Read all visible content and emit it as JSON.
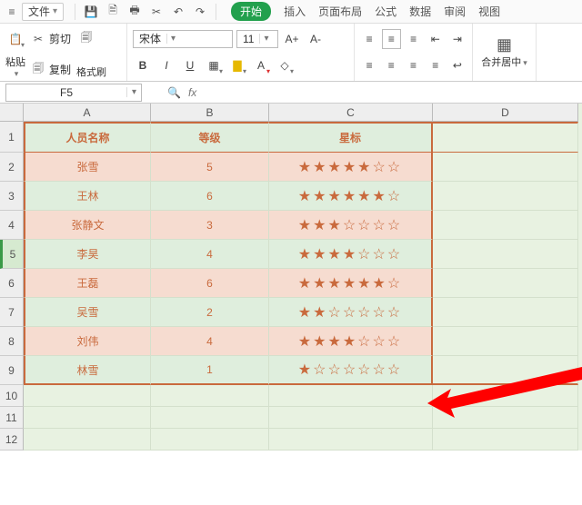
{
  "menubar": {
    "file_label": "文件",
    "tabs": [
      "开始",
      "插入",
      "页面布局",
      "公式",
      "数据",
      "审阅",
      "视图"
    ],
    "active_tab": "开始"
  },
  "ribbon": {
    "cut": "剪切",
    "copy": "复制",
    "paste": "粘贴",
    "format_painter": "格式刷",
    "font_name": "宋体",
    "font_size": "11",
    "increase_font": "A+",
    "decrease_font": "A-",
    "merge": "合并居中"
  },
  "namebox": "F5",
  "columns": [
    "A",
    "B",
    "C",
    "D"
  ],
  "headers": {
    "name": "人员名称",
    "level": "等级",
    "stars": "星标"
  },
  "rows": [
    {
      "name": "张雪",
      "level": "5",
      "stars": "★★★★★☆☆"
    },
    {
      "name": "王林",
      "level": "6",
      "stars": "★★★★★★☆"
    },
    {
      "name": "张静文",
      "level": "3",
      "stars": "★★★☆☆☆☆"
    },
    {
      "name": "李昊",
      "level": "4",
      "stars": "★★★★☆☆☆"
    },
    {
      "name": "王磊",
      "level": "6",
      "stars": "★★★★★★☆"
    },
    {
      "name": "吴雪",
      "level": "2",
      "stars": "★★☆☆☆☆☆"
    },
    {
      "name": "刘伟",
      "level": "4",
      "stars": "★★★★☆☆☆"
    },
    {
      "name": "林雪",
      "level": "1",
      "stars": "★☆☆☆☆☆☆"
    }
  ],
  "selected_row": 5,
  "empty_rows": [
    10,
    11,
    12
  ]
}
